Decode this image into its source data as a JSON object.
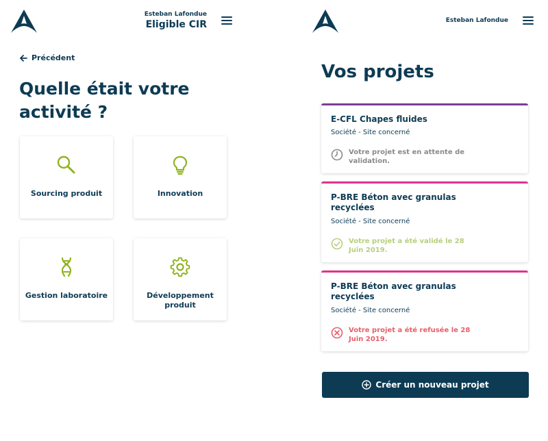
{
  "left_screen": {
    "header": {
      "user_name": "Esteban Lafondue",
      "user_status": "Eligible CIR"
    },
    "back_label": "Précédent",
    "question": "Quelle était votre activité ?",
    "activities": [
      {
        "label": "Sourcing produit",
        "icon": "magnifier-icon"
      },
      {
        "label": "Innovation",
        "icon": "lightbulb-icon"
      },
      {
        "label": "Gestion laboratoire",
        "icon": "dna-icon"
      },
      {
        "label": "Développement produit",
        "icon": "gear-icon"
      }
    ]
  },
  "right_screen": {
    "header": {
      "user_name": "Esteban Lafondue"
    },
    "title": "Vos projets",
    "projects": [
      {
        "title": "E-CFL Chapes fluides",
        "subtitle": "Société - Site concerné",
        "status": "pending",
        "status_text": "Votre projet est en attente de validation.",
        "accent": "#7d3c98",
        "status_color": "#8a8a8a"
      },
      {
        "title": "P-BRE Béton avec granulas recyclées",
        "subtitle": "Société - Site concerné",
        "status": "validated",
        "status_text": "Votre projet a été validé le 28 Juin 2019.",
        "accent": "#e0338b",
        "status_color": "#b7cf7d"
      },
      {
        "title": "P-BRE Béton avec granulas recyclées",
        "subtitle": "Société - Site concerné",
        "status": "refused",
        "status_text": "Votre projet a été refusée le 28 Juin 2019.",
        "accent": "#e0338b",
        "status_color": "#e4606b"
      }
    ],
    "new_project_label": "Créer un nouveau projet"
  },
  "colors": {
    "navy": "#0d3b54",
    "icon_green": "#8fb31f",
    "purple": "#7d3c98",
    "pink": "#e0338b"
  }
}
